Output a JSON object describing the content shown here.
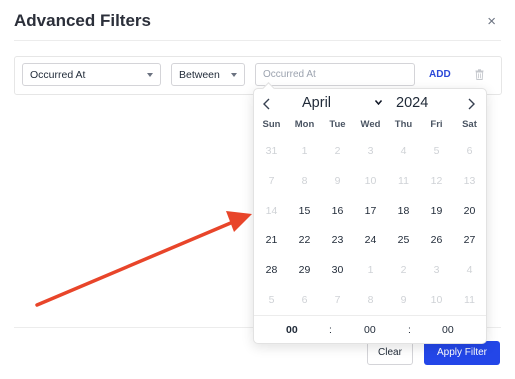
{
  "dialog": {
    "title": "Advanced Filters",
    "close_glyph": "×"
  },
  "filter": {
    "field_value": "Occurred At",
    "operator_value": "Between",
    "date_placeholder": "Occurred At",
    "add_label": "ADD",
    "remove_icon": "trash-icon"
  },
  "calendar": {
    "month": "April",
    "year": "2024",
    "weekdays": [
      "Sun",
      "Mon",
      "Tue",
      "Wed",
      "Thu",
      "Fri",
      "Sat"
    ],
    "weeks": [
      [
        {
          "d": "31",
          "m": true
        },
        {
          "d": "1",
          "m": true
        },
        {
          "d": "2",
          "m": true
        },
        {
          "d": "3",
          "m": true
        },
        {
          "d": "4",
          "m": true
        },
        {
          "d": "5",
          "m": true
        },
        {
          "d": "6",
          "m": true
        }
      ],
      [
        {
          "d": "7",
          "m": true
        },
        {
          "d": "8",
          "m": true
        },
        {
          "d": "9",
          "m": true
        },
        {
          "d": "10",
          "m": true
        },
        {
          "d": "11",
          "m": true
        },
        {
          "d": "12",
          "m": true
        },
        {
          "d": "13",
          "m": true
        }
      ],
      [
        {
          "d": "14",
          "m": true
        },
        {
          "d": "15",
          "m": false
        },
        {
          "d": "16",
          "m": false
        },
        {
          "d": "17",
          "m": false
        },
        {
          "d": "18",
          "m": false
        },
        {
          "d": "19",
          "m": false
        },
        {
          "d": "20",
          "m": false
        }
      ],
      [
        {
          "d": "21",
          "m": false
        },
        {
          "d": "22",
          "m": false
        },
        {
          "d": "23",
          "m": false
        },
        {
          "d": "24",
          "m": false
        },
        {
          "d": "25",
          "m": false
        },
        {
          "d": "26",
          "m": false
        },
        {
          "d": "27",
          "m": false
        }
      ],
      [
        {
          "d": "28",
          "m": false
        },
        {
          "d": "29",
          "m": false
        },
        {
          "d": "30",
          "m": false
        },
        {
          "d": "1",
          "m": true
        },
        {
          "d": "2",
          "m": true
        },
        {
          "d": "3",
          "m": true
        },
        {
          "d": "4",
          "m": true
        }
      ],
      [
        {
          "d": "5",
          "m": true
        },
        {
          "d": "6",
          "m": true
        },
        {
          "d": "7",
          "m": true
        },
        {
          "d": "8",
          "m": true
        },
        {
          "d": "9",
          "m": true
        },
        {
          "d": "10",
          "m": true
        },
        {
          "d": "11",
          "m": true
        }
      ]
    ],
    "time": {
      "hour": "00",
      "minute": "00",
      "second": "00",
      "separator": ":"
    }
  },
  "footer": {
    "clear_label": "Clear",
    "apply_label": "Apply Filter"
  },
  "colors": {
    "accent": "#2346e8",
    "annotation_arrow": "#e8452a"
  }
}
